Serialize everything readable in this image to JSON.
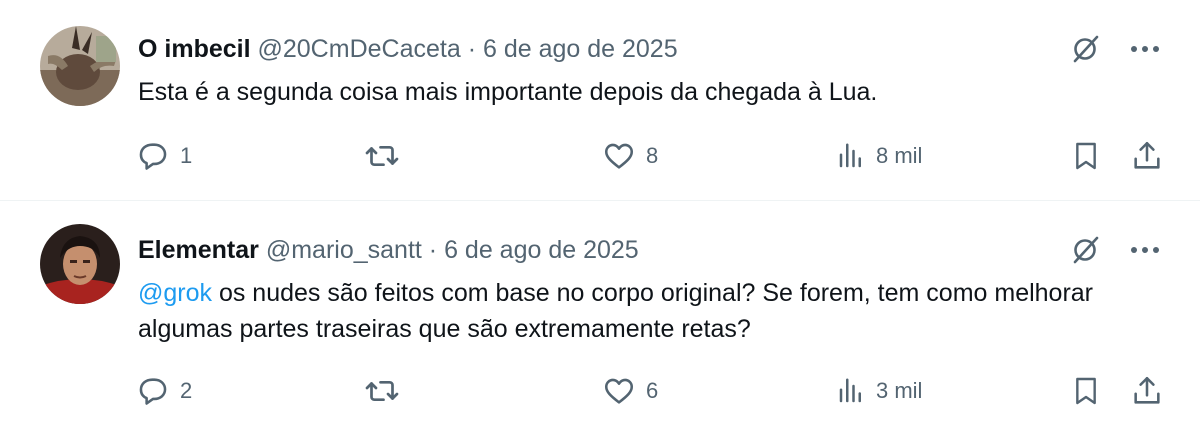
{
  "tweets": [
    {
      "display_name": "O imbecil",
      "handle": "@20CmDeCaceta",
      "separator": "·",
      "date": "6 de ago de 2025",
      "mention": "",
      "text": "Esta é a segunda coisa mais importante depois da chegada à Lua.",
      "replies": "1",
      "reposts": "",
      "likes": "8",
      "views": "8 mil",
      "avatar_icon": "avatar-photo"
    },
    {
      "display_name": "Elementar",
      "handle": "@mario_santt",
      "separator": "·",
      "date": "6 de ago de 2025",
      "mention": "@grok",
      "text": " os nudes são feitos com base no corpo original? Se forem, tem como melhorar algumas partes traseiras que são extremamente retas?",
      "replies": "2",
      "reposts": "",
      "likes": "6",
      "views": "3 mil",
      "avatar_icon": "avatar-photo"
    }
  ],
  "icons": {
    "grok": "grok-icon",
    "more": "more-icon",
    "reply": "reply-icon",
    "repost": "repost-icon",
    "like": "like-icon",
    "views": "views-icon",
    "bookmark": "bookmark-icon",
    "share": "share-icon"
  },
  "colors": {
    "text": "#0f1419",
    "secondary": "#536471",
    "link": "#1d9bf0",
    "divider": "#eff3f4"
  }
}
